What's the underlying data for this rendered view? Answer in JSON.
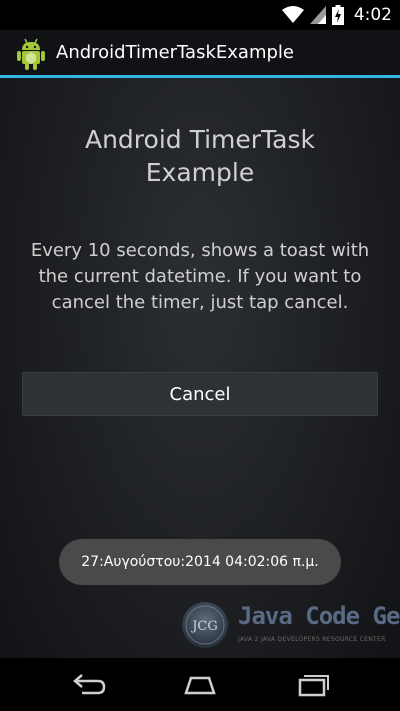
{
  "status_bar": {
    "time": "4:02",
    "icons": [
      "wifi-icon",
      "signal-icon",
      "battery-charging-icon"
    ]
  },
  "action_bar": {
    "title": "AndroidTimerTaskExample",
    "icon": "android-app-icon"
  },
  "content": {
    "headline": "Android TimerTask Example",
    "description": "Every 10 seconds, shows a toast with the current datetime. If you want to cancel the timer, just tap cancel.",
    "cancel_button_label": "Cancel"
  },
  "toast": {
    "text": "27:Αυγούστου:2014 04:02:06 π.μ."
  },
  "watermark": {
    "name": "Java Code Geeks",
    "tagline": "JAVA 2 JAVA DEVELOPERS RESOURCE CENTER",
    "logo_initials": "JCG"
  },
  "nav_bar": {
    "icons": [
      "back-icon",
      "home-icon",
      "recent-apps-icon"
    ]
  },
  "colors": {
    "accent": "#33b5e5",
    "toast_bg": "#4a4a4a",
    "button_bg": "#2e3236"
  }
}
